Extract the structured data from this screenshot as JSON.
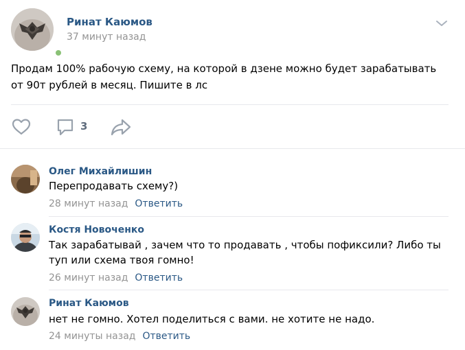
{
  "post": {
    "author": "Ринат Каюмов",
    "time": "37 минут назад",
    "text": "Продам 100% рабочую схему, на которой в дзене можно будет зарабатывать от 90т рублей в месяц. Пишите в лс",
    "comments_count": "3",
    "author_online": true
  },
  "icons": {
    "post_menu": "chevron-down-icon",
    "like": "heart-icon",
    "comment": "comment-icon",
    "share": "share-icon",
    "online": "online-indicator"
  },
  "comments": [
    {
      "author": "Олег Михайлишин",
      "text": "Перепродавать схему?)",
      "time": "28 минут назад",
      "reply": "Ответить"
    },
    {
      "author": "Костя Новоченко",
      "text": "Так зарабатывай , зачем что то продавать , чтобы пофиксили? Либо ты туп или схема твоя гомно!",
      "time": "26 минут назад",
      "reply": "Ответить"
    },
    {
      "author": "Ринат Каюмов",
      "text": "нет не гомно. Хотел поделиться с вами. не хотите не надо.",
      "time": "24 минуты назад",
      "reply": "Ответить"
    }
  ],
  "colors": {
    "link": "#2a5885",
    "muted": "#939393",
    "icon": "#99a2ad",
    "online": "#8ac176",
    "divider": "#e7e8ec"
  }
}
